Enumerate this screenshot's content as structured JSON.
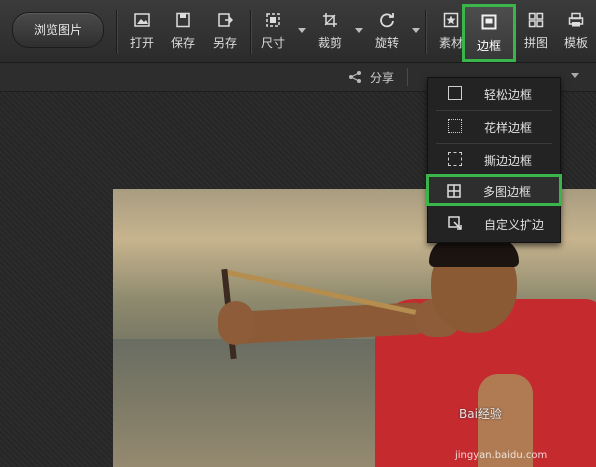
{
  "toolbar": {
    "browse_label": "浏览图片",
    "tools": [
      {
        "id": "open",
        "label": "打开",
        "icon": "image-open-icon"
      },
      {
        "id": "save",
        "label": "保存",
        "icon": "save-icon"
      },
      {
        "id": "saveas",
        "label": "另存",
        "icon": "save-as-icon"
      },
      {
        "id": "size",
        "label": "尺寸",
        "icon": "resize-icon"
      },
      {
        "id": "crop",
        "label": "裁剪",
        "icon": "crop-icon"
      },
      {
        "id": "rotate",
        "label": "旋转",
        "icon": "rotate-icon"
      },
      {
        "id": "material",
        "label": "素材",
        "icon": "star-image-icon"
      },
      {
        "id": "border",
        "label": "边框",
        "icon": "frame-icon"
      },
      {
        "id": "collage",
        "label": "拼图",
        "icon": "grid-icon"
      },
      {
        "id": "template",
        "label": "模板",
        "icon": "printer-icon"
      }
    ]
  },
  "subbar": {
    "share_label": "分享"
  },
  "border_menu": {
    "items": [
      {
        "label": "轻松边框",
        "icon": "simple-frame-icon"
      },
      {
        "label": "花样边框",
        "icon": "pattern-frame-icon"
      },
      {
        "label": "撕边边框",
        "icon": "torn-frame-icon"
      },
      {
        "label": "多图边框",
        "icon": "multi-frame-icon"
      },
      {
        "label": "自定义扩边",
        "icon": "custom-expand-icon"
      }
    ],
    "highlighted_index": 3
  },
  "watermark": {
    "text": "Bai经验",
    "sub": "jingyan.baidu.com"
  },
  "colors": {
    "highlight": "#39b54a",
    "toolbar": "#333333"
  }
}
